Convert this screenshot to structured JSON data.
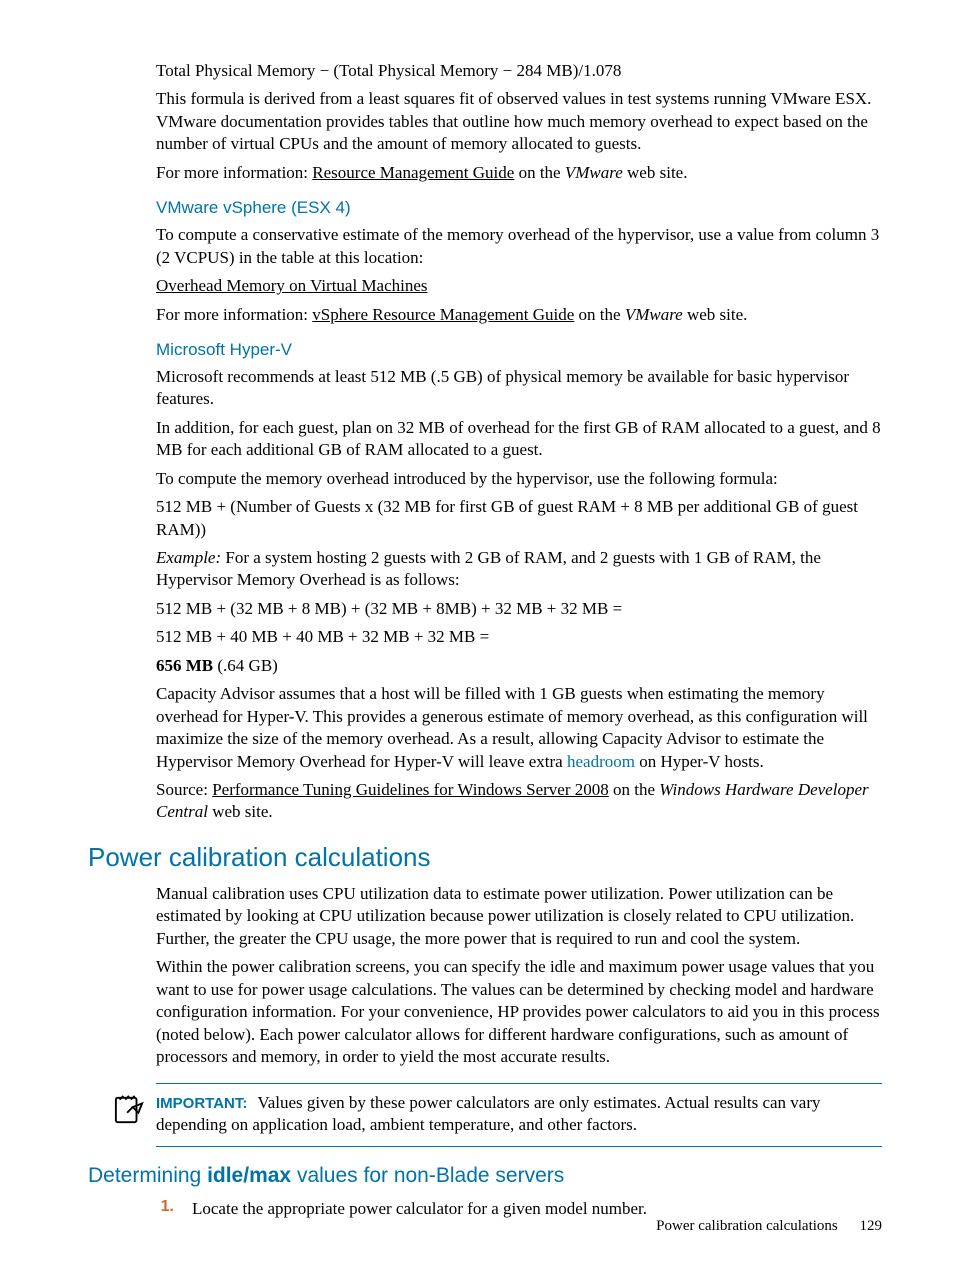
{
  "intro": {
    "formula_line": "Total Physical Memory − (Total Physical Memory − 284 MB)/1.078",
    "derivation": "This formula is derived from a least squares fit of observed values in test systems running VMware ESX. VMware documentation provides tables that outline how much memory overhead to expect based on the number of virtual CPUs and the amount of memory allocated to guests.",
    "moreinfo_pre": "For more information: ",
    "moreinfo_link": "Resource Management Guide",
    "moreinfo_post": " on the ",
    "moreinfo_site": "VMware",
    "moreinfo_tail": " web site."
  },
  "vsphere": {
    "heading": "VMware vSphere (ESX 4)",
    "p1": "To compute a conservative estimate of the memory overhead of the hypervisor, use a value from column 3 (2 VCPUS) in the table at this location:",
    "link1": "Overhead Memory on Virtual Machines",
    "moreinfo_pre": "For more information: ",
    "moreinfo_link": "vSphere Resource Management Guide",
    "moreinfo_post": " on the ",
    "moreinfo_site": "VMware",
    "moreinfo_tail": " web site."
  },
  "hyperv": {
    "heading": "Microsoft Hyper-V",
    "p1": "Microsoft recommends at least 512 MB (.5 GB) of physical memory be available for basic hypervisor features.",
    "p2": "In addition, for each guest, plan on 32 MB of overhead for the first GB of RAM allocated to a guest, and 8 MB for each additional GB of RAM allocated to a guest.",
    "p3": "To compute the memory overhead introduced by the hypervisor, use the following formula:",
    "p4": "512 MB + (Number of Guests x (32 MB for first GB of guest RAM + 8 MB per additional GB of guest RAM))",
    "ex_label": "Example:",
    "p5": "  For a system hosting 2 guests with 2 GB of RAM, and 2 guests with 1 GB of RAM, the Hypervisor Memory Overhead is as follows:",
    "p6": "512 MB + (32 MB + 8 MB) + (32 MB + 8MB) + 32 MB + 32 MB =",
    "p7": "512 MB + 40 MB + 40 MB + 32 MB + 32 MB =",
    "p8_bold": "656 MB",
    "p8_rest": " (.64 GB)",
    "p9a": "Capacity Advisor assumes that a host will be filled with 1 GB guests when estimating the memory overhead for Hyper-V. This provides a generous estimate of memory overhead, as this configuration will maximize the size of the memory overhead. As a result, allowing Capacity Advisor to estimate the Hypervisor Memory Overhead for Hyper-V will leave extra ",
    "p9_link": "headroom",
    "p9b": " on Hyper-V hosts.",
    "src_pre": "Source: ",
    "src_link": "Performance Tuning Guidelines for Windows Server 2008",
    "src_mid": " on the ",
    "src_site": "Windows Hardware Developer Central",
    "src_tail": " web site."
  },
  "power": {
    "heading": "Power calibration calculations",
    "p1": "Manual calibration uses CPU utilization data to estimate power utilization. Power utilization can be estimated by looking at CPU utilization because power utilization is closely related to CPU utilization. Further, the greater the CPU usage, the more power that is required to run and cool the system.",
    "p2": "Within the power calibration screens, you can specify the idle and maximum power usage values that you want to use for power usage calculations. The values can be determined by checking model and hardware configuration information. For your convenience, HP provides power calculators to aid you in this process (noted below). Each power calculator allows for different hardware configurations, such as amount of processors and memory, in order to yield the most accurate results."
  },
  "important": {
    "label": "IMPORTANT:",
    "text": "Values given by these power calculators are only estimates. Actual results can vary depending on application load, ambient temperature, and other factors."
  },
  "idlemax": {
    "heading_pre": "Determining ",
    "heading_bold": "idle/max",
    "heading_post": " values for non-Blade servers",
    "item1_num": "1.",
    "item1_text": "Locate the appropriate power calculator for a given model number."
  },
  "footer": {
    "title": "Power calibration calculations",
    "page": "129"
  }
}
